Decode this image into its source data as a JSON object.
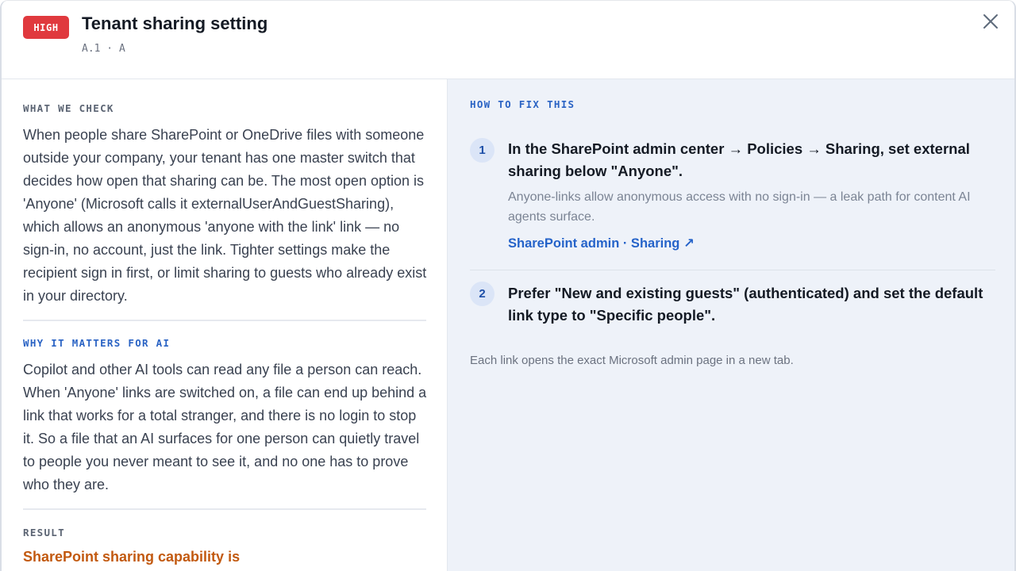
{
  "header": {
    "severity": "HIGH",
    "title": "Tenant sharing setting",
    "subtitle": "A.1 · A",
    "severity_color": "#e0393e"
  },
  "left": {
    "what_we_check": {
      "label": "WHAT WE CHECK",
      "text": "When people share SharePoint or OneDrive files with someone outside your company, your tenant has one master switch that decides how open that sharing can be. The most open option is 'Anyone' (Microsoft calls it externalUserAndGuestSharing), which allows an anonymous 'anyone with the link' link — no sign-in, no account, just the link. Tighter settings make the recipient sign in first, or limit sharing to guests who already exist in your directory."
    },
    "why_it_matters": {
      "label": "WHY IT MATTERS FOR AI",
      "text": "Copilot and other AI tools can read any file a person can reach. When 'Anyone' links are switched on, a file can end up behind a link that works for a total stranger, and there is no login to stop it. So a file that an AI surfaces for one person can quietly travel to people you never meant to see it, and no one has to prove who they are."
    },
    "result": {
      "label": "RESULT",
      "text": "SharePoint sharing capability is",
      "color": "#c2590f"
    }
  },
  "right": {
    "label": "HOW TO FIX THIS",
    "steps": [
      {
        "number": "1",
        "title": "In the SharePoint admin center → Policies → Sharing, set external sharing below \"Anyone\".",
        "description": "Anyone-links allow anonymous access with no sign-in — a leak path for content AI agents surface.",
        "link": "SharePoint admin · Sharing ↗"
      },
      {
        "number": "2",
        "title": "Prefer \"New and existing guests\" (authenticated) and set the default link type to \"Specific people\"."
      }
    ],
    "footnote": "Each link opens the exact Microsoft admin page in a new tab."
  },
  "icons": {
    "close": "close-icon"
  },
  "colors": {
    "accent_blue": "#2a63c4",
    "panel_background": "#eef2f9"
  }
}
